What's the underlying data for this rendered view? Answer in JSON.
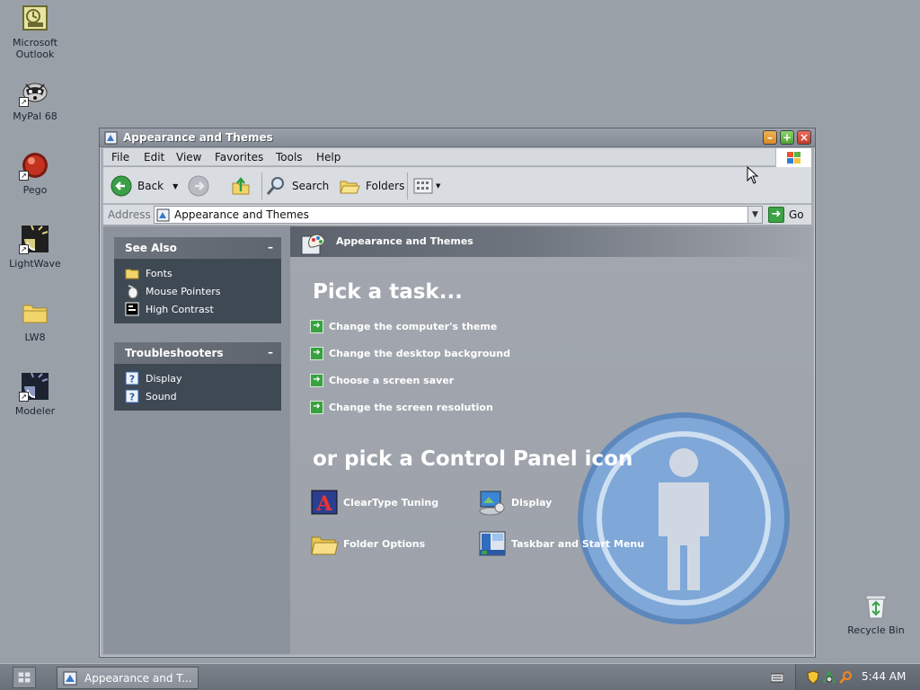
{
  "desktop": {
    "icons": [
      {
        "label": "Microsoft Outlook",
        "icon": "outlook-icon"
      },
      {
        "label": "MyPal 68",
        "icon": "raccoon-icon"
      },
      {
        "label": "Pego",
        "icon": "red-ball-icon"
      },
      {
        "label": "LightWave",
        "icon": "lightwave-icon"
      },
      {
        "label": "LW8",
        "icon": "folder-icon"
      },
      {
        "label": "Modeler",
        "icon": "modeler-icon"
      },
      {
        "label": "Recycle Bin",
        "icon": "recycle-bin-icon"
      }
    ]
  },
  "window": {
    "title": "Appearance and Themes",
    "menu": [
      "File",
      "Edit",
      "View",
      "Favorites",
      "Tools",
      "Help"
    ],
    "toolbar": {
      "back": "Back",
      "search": "Search",
      "folders": "Folders"
    },
    "address": {
      "label": "Address",
      "value": "Appearance and Themes",
      "go": "Go"
    }
  },
  "sidebar": {
    "see_also": {
      "title": "See Also",
      "items": [
        "Fonts",
        "Mouse Pointers",
        "High Contrast"
      ]
    },
    "troubleshooters": {
      "title": "Troubleshooters",
      "items": [
        "Display",
        "Sound"
      ]
    },
    "collapse_glyph": "–"
  },
  "main": {
    "header": "Appearance and Themes",
    "pick_task_title": "Pick a task...",
    "tasks": [
      "Change the computer's theme",
      "Change the desktop background",
      "Choose a screen saver",
      "Change the screen resolution"
    ],
    "pick_icon_title": "or pick a Control Panel icon",
    "icons": [
      "ClearType Tuning",
      "Display",
      "Folder Options",
      "Taskbar and Start Menu"
    ]
  },
  "taskbar": {
    "window_button": "Appearance and T...",
    "clock": "5:44 AM"
  },
  "colors": {
    "desktop": "#9aa0a8",
    "sidebar_box": "#3f4954",
    "task_arrow": "#38a240"
  }
}
